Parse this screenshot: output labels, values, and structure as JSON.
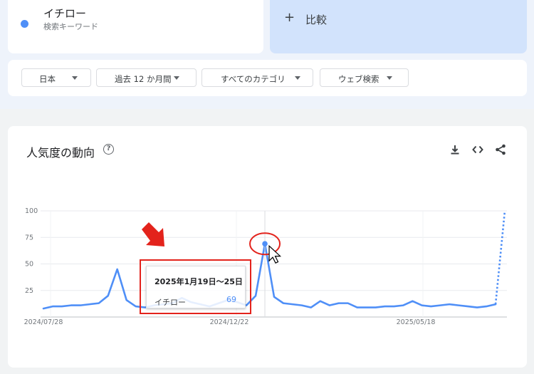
{
  "search_term": {
    "name": "イチロー",
    "type_label": "検索キーワード",
    "color": "#4f8ff7"
  },
  "compare": {
    "plus": "+",
    "label": "比較"
  },
  "filters": [
    {
      "label": "日本"
    },
    {
      "label": "過去 12 か月間"
    },
    {
      "label": "すべてのカテゴリ"
    },
    {
      "label": "ウェブ検索"
    }
  ],
  "panel": {
    "title": "人気度の動向",
    "help_icon": "help-circle-icon",
    "tools": [
      "download-icon",
      "embed-code-icon",
      "share-icon"
    ]
  },
  "chart_data": {
    "type": "line",
    "y_ticks": [
      "100",
      "75",
      "50",
      "25"
    ],
    "ylim": [
      0,
      100
    ],
    "x_ticks": [
      "2024/07/28",
      "2024/12/22",
      "2025/05/18"
    ],
    "series": [
      {
        "name": "イチロー",
        "color": "#4f8ff7",
        "values": [
          8,
          10,
          10,
          11,
          11,
          12,
          13,
          20,
          45,
          16,
          10,
          9,
          11,
          12,
          13,
          18,
          14,
          12,
          10,
          13,
          16,
          14,
          11,
          20,
          69,
          19,
          13,
          12,
          11,
          9,
          15,
          11,
          13,
          13,
          9,
          9,
          9,
          10,
          10,
          11,
          15,
          11,
          10,
          11,
          12,
          11,
          10,
          9,
          10,
          12,
          100
        ],
        "partial_last_point": true
      }
    ],
    "highlight": {
      "index": 24,
      "date_label": "2025年1月19日〜25日",
      "value": "69"
    },
    "grid": true
  },
  "tooltip": {
    "date": "2025年1月19日〜25日",
    "series_name": "イチロー",
    "value": "69"
  },
  "annotation": {
    "arrow_color": "#e3231c"
  }
}
